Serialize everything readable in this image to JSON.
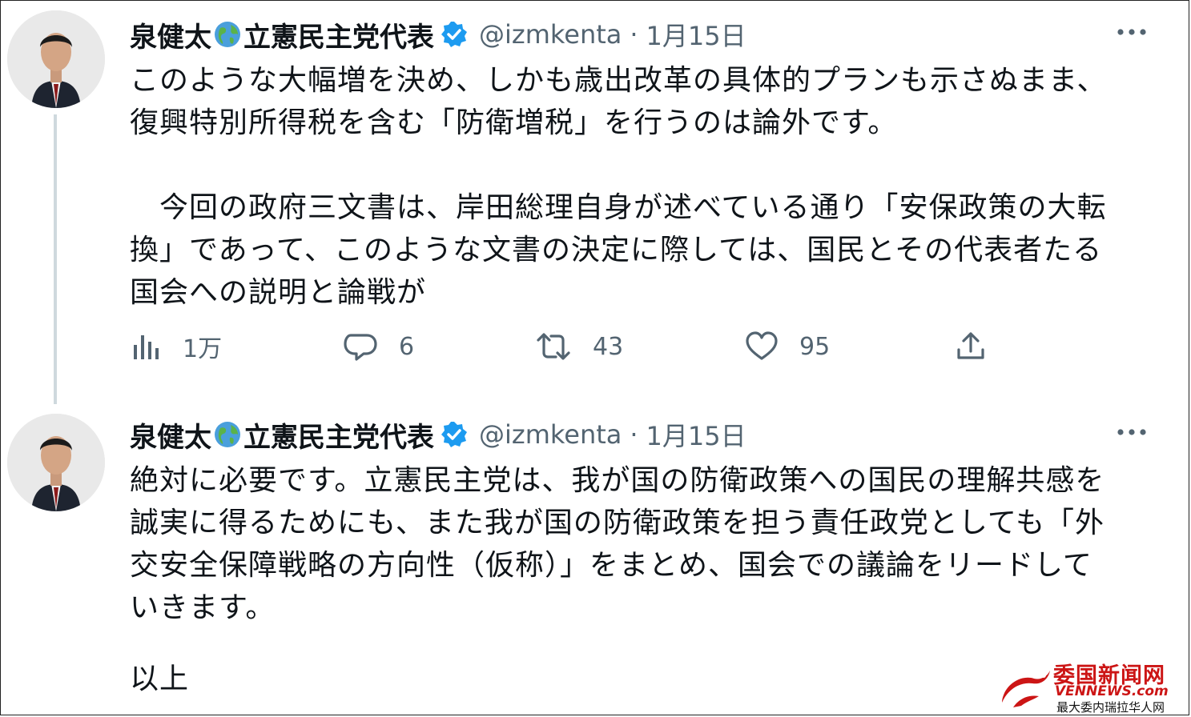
{
  "tweets": [
    {
      "display_name": "泉健太",
      "name_suffix": "立憲民主党代表",
      "handle": "@izmkenta",
      "separator": "·",
      "date": "1月15日",
      "paragraphs": [
        "このような大幅増を決め、しかも歳出改革の具体的プランも示さぬまま、\n復興特別所得税を含む「防衛増税」を行うのは論外です。",
        "　今回の政府三文書は、岸田総理自身が述べている通り「安保政策の大転\n換」であって、このような文書の決定に際しては、国民とその代表者たる\n国会への説明と論戦が"
      ],
      "stats": {
        "views": "1万",
        "replies": "6",
        "retweets": "43",
        "likes": "95"
      }
    },
    {
      "display_name": "泉健太",
      "name_suffix": "立憲民主党代表",
      "handle": "@izmkenta",
      "separator": "·",
      "date": "1月15日",
      "paragraphs": [
        "絶対に必要です。立憲民主党は、我が国の防衛政策への国民の理解共感を\n誠実に得るためにも、また我が国の防衛政策を担う責任政党としても「外\n交安全保障戦略の方向性（仮称）」をまとめ、国会での議論をリードして\nいきます。",
        "以上"
      ]
    }
  ],
  "watermark": {
    "title": "委国新闻网",
    "site": "VENNEWS.com",
    "subtitle": "最大委内瑞拉华人网"
  },
  "icons": {
    "globe": "globe-americas-icon",
    "verified": "verified-badge-icon",
    "more": "more-options-icon",
    "views": "views-chart-icon",
    "reply": "reply-bubble-icon",
    "retweet": "retweet-icon",
    "like": "heart-icon",
    "share": "share-upload-icon"
  },
  "colors": {
    "verified": "#1d9bf0",
    "secondary_text": "#536471",
    "watermark": "#cc1515"
  }
}
